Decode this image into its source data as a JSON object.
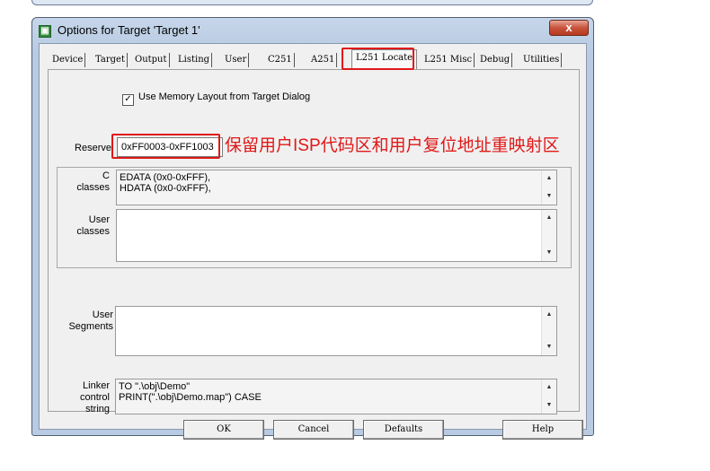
{
  "window": {
    "title": "Options for Target 'Target 1'",
    "close_glyph": "x"
  },
  "tabs": [
    {
      "label": "Device"
    },
    {
      "label": "Target"
    },
    {
      "label": "Output"
    },
    {
      "label": "Listing"
    },
    {
      "label": "User"
    },
    {
      "label": "C251"
    },
    {
      "label": "A251"
    },
    {
      "label": "L251 Locate",
      "active": true
    },
    {
      "label": "L251 Misc"
    },
    {
      "label": "Debug"
    },
    {
      "label": "Utilities"
    }
  ],
  "locate": {
    "use_memory_layout_label": "Use Memory Layout from Target Dialog",
    "use_memory_layout_checked": true,
    "reserve_label": "Reserve",
    "reserve_value": "0xFF0003-0xFF1003",
    "annotation": "保留用户ISP代码区和用户复位地址重映射区",
    "c_classes_label_1": "C",
    "c_classes_label_2": "classes",
    "c_classes_lines": [
      "EDATA (0x0-0xFFF),",
      "HDATA (0x0-0xFFF),"
    ],
    "user_classes_label_1": "User",
    "user_classes_label_2": "classes",
    "user_segments_label_1": "User",
    "user_segments_label_2": "Segments",
    "linker_label_1": "Linker",
    "linker_label_2": "control",
    "linker_label_3": "string",
    "linker_lines": [
      "TO \".\\obj\\Demo\"",
      "PRINT(\".\\obj\\Demo.map\") CASE"
    ]
  },
  "buttons": {
    "ok": "OK",
    "cancel": "Cancel",
    "defaults": "Defaults",
    "help": "Help"
  },
  "colors": {
    "annotation_red": "#e01818",
    "title_bar": "#c6d6ea"
  }
}
